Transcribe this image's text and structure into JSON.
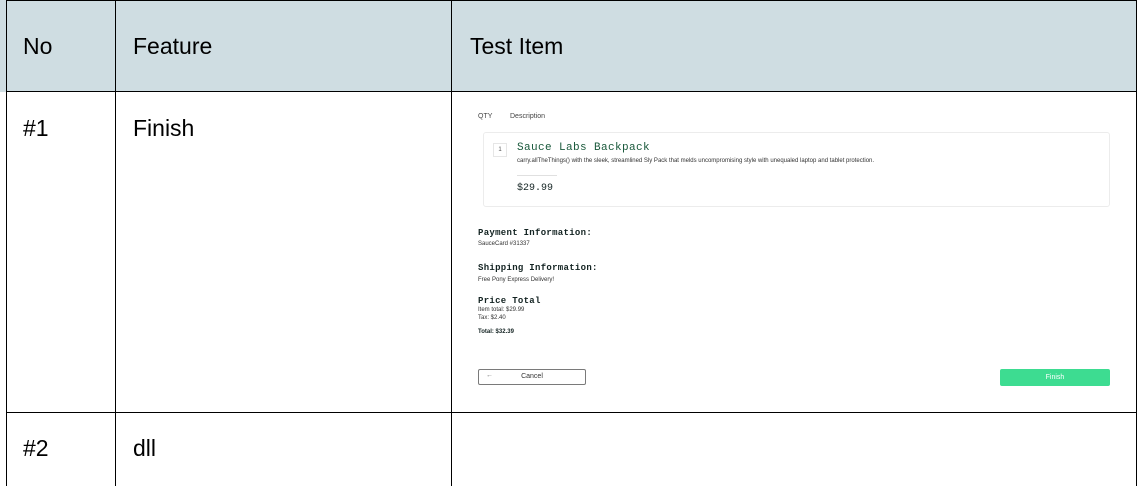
{
  "table": {
    "headers": {
      "no": "No",
      "feature": "Feature",
      "test_item": "Test Item"
    },
    "rows": [
      {
        "no": "#1",
        "feature": "Finish"
      },
      {
        "no": "#2",
        "feature": "dll"
      }
    ]
  },
  "screenshot": {
    "qty_header": "QTY",
    "description_header": "Description",
    "item": {
      "quantity": "1",
      "name": "Sauce Labs Backpack",
      "description": "carry.allTheThings() with the sleek, streamlined Sly Pack that melds uncompromising style with unequaled laptop and tablet protection.",
      "price": "$29.99"
    },
    "payment_label": "Payment Information:",
    "payment_value": "SauceCard #31337",
    "shipping_label": "Shipping Information:",
    "shipping_value": "Free Pony Express Delivery!",
    "price_total_label": "Price Total",
    "item_total": "Item total: $29.99",
    "tax": "Tax: $2.40",
    "total": "Total: $32.39",
    "cancel_label": "Cancel",
    "cancel_arrow": "←",
    "finish_label": "Finish"
  },
  "colors": {
    "header_bg": "#cfdde2",
    "finish_button": "#3ddc91",
    "product_name": "#18583a"
  }
}
